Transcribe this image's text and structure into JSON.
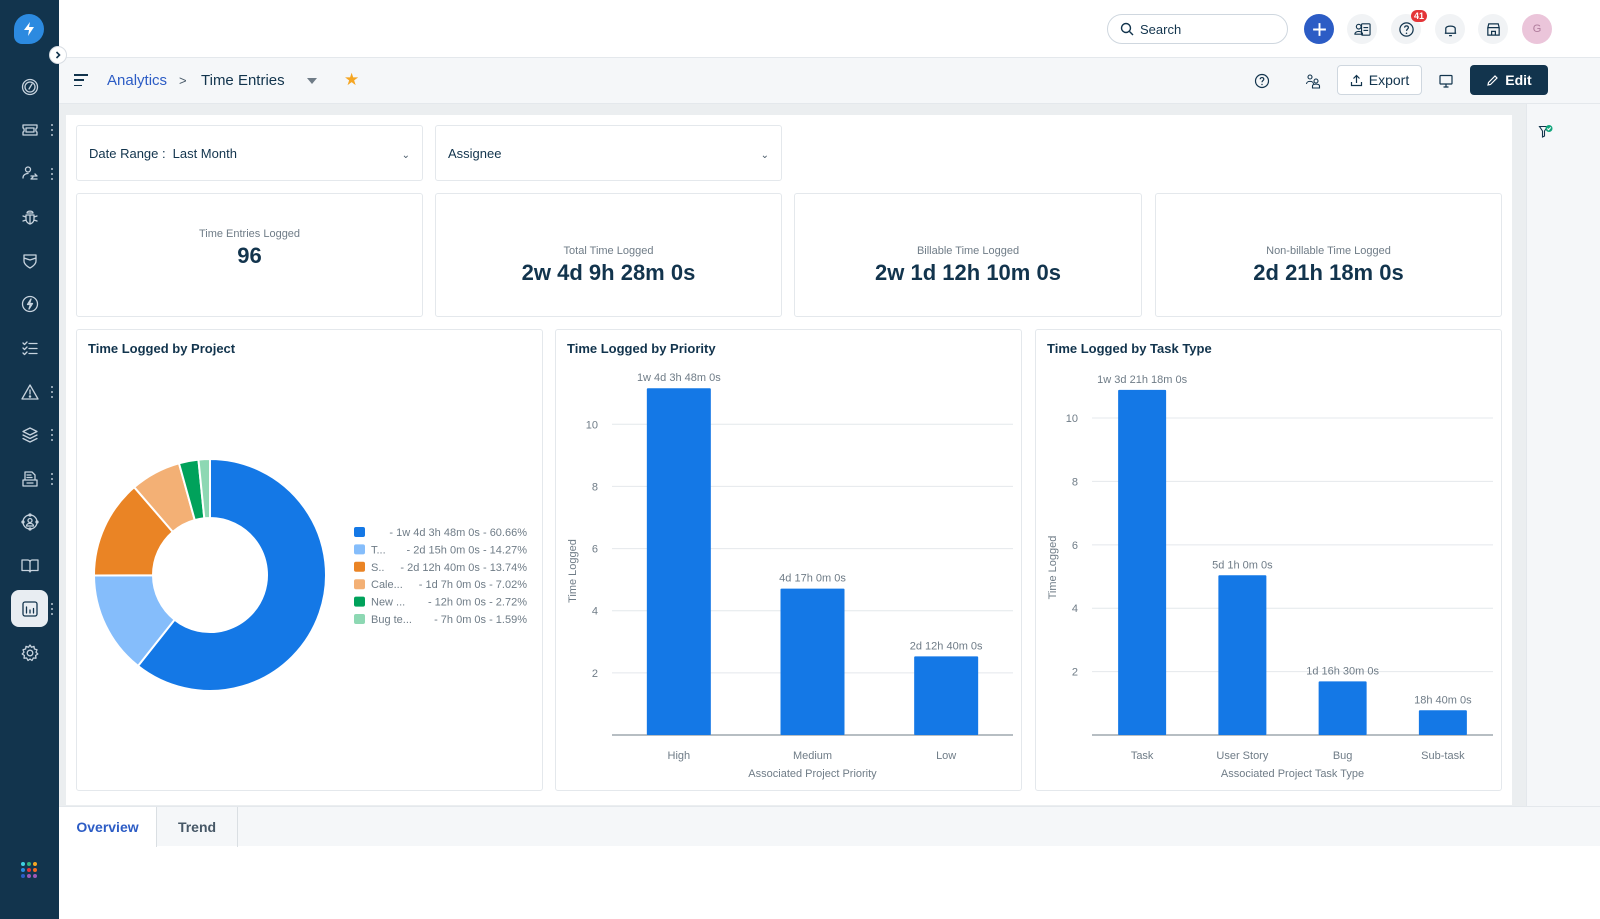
{
  "topbar": {
    "search_placeholder": "Search",
    "help_badge_count": "41",
    "avatar_initial": "G"
  },
  "header": {
    "breadcrumb_parent": "Analytics",
    "breadcrumb_separator": ">",
    "breadcrumb_current": "Time Entries",
    "export_label": "Export",
    "edit_label": "Edit"
  },
  "sidebar": {
    "items": [
      {
        "icon": "dashboard-icon",
        "has_menu": false,
        "active": false
      },
      {
        "icon": "ticket-icon",
        "has_menu": true,
        "active": false
      },
      {
        "icon": "contacts-icon",
        "has_menu": true,
        "active": false
      },
      {
        "icon": "bug-icon",
        "has_menu": false,
        "active": false
      },
      {
        "icon": "shield-icon",
        "has_menu": false,
        "active": false
      },
      {
        "icon": "bolt-icon",
        "has_menu": false,
        "active": false
      },
      {
        "icon": "checklist-icon",
        "has_menu": false,
        "active": false
      },
      {
        "icon": "alert-icon",
        "has_menu": true,
        "active": false
      },
      {
        "icon": "layers-icon",
        "has_menu": true,
        "active": false
      },
      {
        "icon": "document-icon",
        "has_menu": true,
        "active": false
      },
      {
        "icon": "people-icon",
        "has_menu": false,
        "active": false
      },
      {
        "icon": "book-icon",
        "has_menu": false,
        "active": false
      },
      {
        "icon": "analytics-icon",
        "has_menu": true,
        "active": true
      },
      {
        "icon": "settings-icon",
        "has_menu": false,
        "active": false
      }
    ],
    "apps_colors": [
      "#3ed1e0",
      "#36b37e",
      "#f5a623",
      "#2c8ae0",
      "#e43538",
      "#f56a1f",
      "#2c5cc5",
      "#9b59b6",
      "#9b59b6"
    ]
  },
  "filters": {
    "date_range_label": "Date Range :",
    "date_range_value": "Last Month",
    "assignee_label": "Assignee"
  },
  "kpis": [
    {
      "label": "Time Entries Logged",
      "value": "96"
    },
    {
      "label": "Total Time Logged",
      "value": "2w 4d 9h 28m 0s"
    },
    {
      "label": "Billable Time Logged",
      "value": "2w 1d 12h 10m 0s"
    },
    {
      "label": "Non-billable Time Logged",
      "value": "2d 21h 18m 0s"
    }
  ],
  "tabs": [
    {
      "label": "Overview",
      "active": true
    },
    {
      "label": "Trend",
      "active": false
    }
  ],
  "chart_data": [
    {
      "type": "pie",
      "title": "Time Logged by Project",
      "donut": true,
      "legend_position": "right",
      "slices": [
        {
          "label": "",
          "value_text": "1w 4d 3h 48m 0s",
          "percent": 60.66,
          "color": "#1478e6"
        },
        {
          "label": "T...",
          "value_text": "2d 15h 0m 0s",
          "percent": 14.27,
          "color": "#85bdfb"
        },
        {
          "label": "S..",
          "value_text": "2d 12h 40m 0s",
          "percent": 13.74,
          "color": "#ea8425"
        },
        {
          "label": "Cale...",
          "value_text": "1d 7h 0m 0s",
          "percent": 7.02,
          "color": "#f3b075"
        },
        {
          "label": "New ...",
          "value_text": "12h 0m 0s",
          "percent": 2.72,
          "color": "#00a25b"
        },
        {
          "label": "Bug te...",
          "value_text": "7h 0m 0s",
          "percent": 1.59,
          "color": "#8dd8b3"
        }
      ]
    },
    {
      "type": "bar",
      "title": "Time Logged by Priority",
      "xlabel": "Associated Project Priority",
      "ylabel": "Time Logged",
      "ylim": [
        0,
        11.2
      ],
      "yticks": [
        2,
        4,
        6,
        8,
        10
      ],
      "grid": true,
      "color": "#1478e6",
      "categories": [
        "High",
        "Medium",
        "Low"
      ],
      "values": [
        11.16,
        4.71,
        2.53
      ],
      "labels": [
        "1w 4d 3h 48m 0s",
        "4d 17h 0m 0s",
        "2d 12h 40m 0s"
      ]
    },
    {
      "type": "bar",
      "title": "Time Logged by Task Type",
      "xlabel": "Associated Project Task Type",
      "ylabel": "Time Logged",
      "ylim": [
        0,
        11.2
      ],
      "yticks": [
        2,
        4,
        6,
        8,
        10
      ],
      "grid": true,
      "color": "#1478e6",
      "categories": [
        "Task",
        "User Story",
        "Bug",
        "Sub-task"
      ],
      "values": [
        10.89,
        5.04,
        1.69,
        0.78
      ],
      "labels": [
        "1w 3d 21h 18m 0s",
        "5d 1h 0m 0s",
        "1d 16h 30m 0s",
        "18h 40m 0s"
      ]
    }
  ]
}
